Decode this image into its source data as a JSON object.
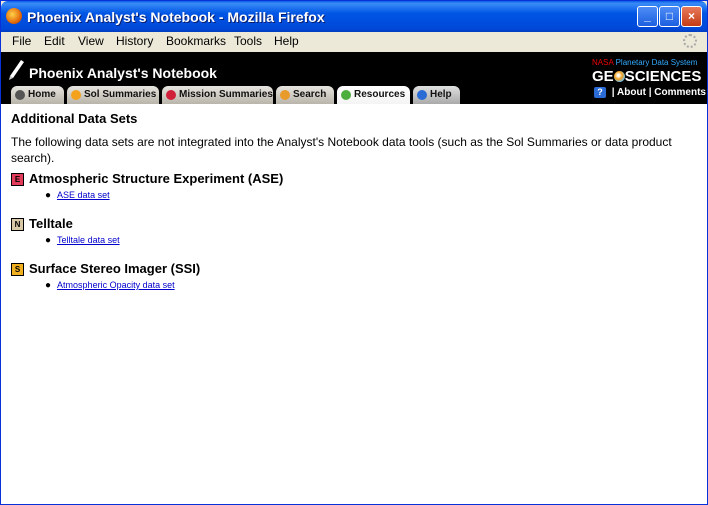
{
  "window": {
    "title": "Phoenix Analyst's Notebook - Mozilla Firefox",
    "buttons": [
      "_",
      "□",
      "×"
    ]
  },
  "menubar": [
    "File",
    "Edit",
    "View",
    "History",
    "Bookmarks",
    "Tools",
    "Help"
  ],
  "header": {
    "site_title": "Phoenix Analyst's Notebook",
    "tabs": [
      {
        "label": "Home",
        "icon": "pencil-icon",
        "active": false
      },
      {
        "label": "Sol Summaries",
        "icon": "sun-icon",
        "active": false
      },
      {
        "label": "Mission Summaries",
        "icon": "target-icon",
        "active": false
      },
      {
        "label": "Search",
        "icon": "search-icon",
        "active": false
      },
      {
        "label": "Resources",
        "icon": "wrench-icon",
        "active": true
      },
      {
        "label": "Help",
        "icon": "help-icon",
        "active": false
      }
    ],
    "nasa_label": "NASA",
    "pds_label": "Planetary Data System",
    "geo_prefix": "GE",
    "geo_suffix": "SCIENCES",
    "toplinks": {
      "about": "About",
      "comments": "Comments",
      "sep": "|"
    }
  },
  "content": {
    "title": "Additional Data Sets",
    "intro": "The following data sets are not integrated into the Analyst's Notebook data tools (such as the Sol Summaries or data product search).",
    "datasets": [
      {
        "badge": "E",
        "badge_color": "#e23c5a",
        "name": "Atmospheric Structure Experiment (ASE)",
        "link": "ASE data set"
      },
      {
        "badge": "N",
        "badge_color": "#d8c8a8",
        "name": "Telltale",
        "link": "Telltale data set"
      },
      {
        "badge": "S",
        "badge_color": "#f0b020",
        "name": "Surface Stereo Imager (SSI)",
        "link": "Atmospheric Opacity data set"
      }
    ]
  }
}
